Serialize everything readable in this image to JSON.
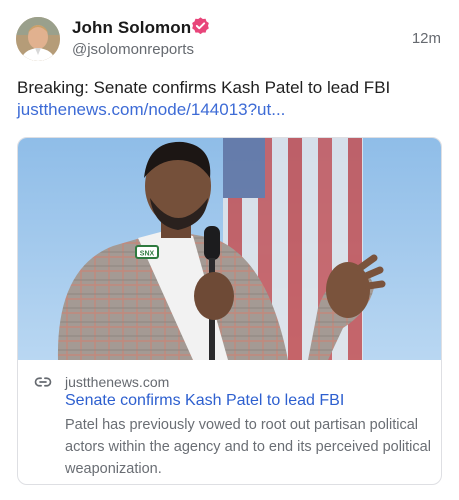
{
  "post": {
    "author_name": "John Solomon",
    "author_handle": "@jsolomonreports",
    "timestamp": "12m",
    "text": "Breaking: Senate confirms Kash Patel to lead FBI",
    "link": "justthenews.com/node/144013?ut..."
  },
  "card": {
    "domain": "justthenews.com",
    "title": "Senate confirms Kash Patel to lead FBI",
    "description": "Patel has previously vowed to root out partisan political actors within the agency and to end its perceived political weaponization.",
    "badge_text": "SNX"
  },
  "colors": {
    "verified": "#e8457a",
    "link": "#3d6bd6",
    "card_title": "#2d5fcf"
  },
  "icons": {
    "verified": "verified-badge-icon",
    "link": "link-chain-icon"
  }
}
